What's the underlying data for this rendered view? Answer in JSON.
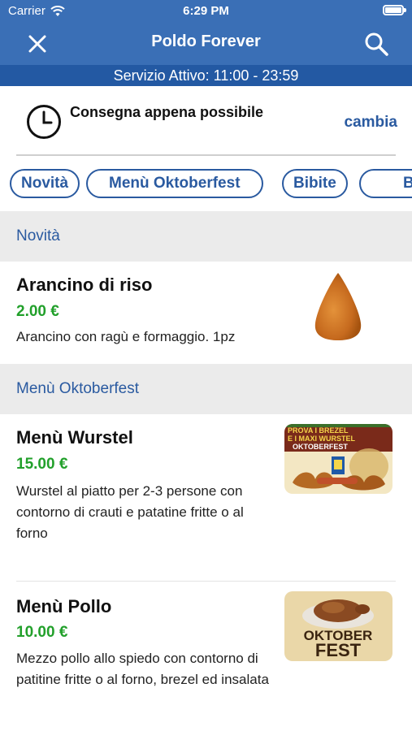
{
  "status": {
    "carrier": "Carrier",
    "time": "6:29 PM"
  },
  "navbar": {
    "title": "Poldo Forever"
  },
  "service": {
    "text": "Servizio Attivo: 11:00 - 23:59"
  },
  "delivery": {
    "text": "Consegna appena possibile",
    "change_label": "cambia"
  },
  "categories": [
    "Novità",
    "Menù Oktoberfest",
    "Bibite",
    "B"
  ],
  "sections": [
    {
      "title": "Novità",
      "items": [
        {
          "name": "Arancino di riso",
          "price": "2.00 €",
          "description": "Arancino con ragù e formaggio. 1pz"
        }
      ]
    },
    {
      "title": "Menù Oktoberfest",
      "items": [
        {
          "name": "Menù Wurstel",
          "price": "15.00 €",
          "description": "Wurstel al piatto per 2-3 persone con contorno di crauti e patatine fritte o al forno",
          "image_text": [
            "PROVA I BREZEL",
            "E I MAXI WURSTEL",
            "OKTOBERFEST"
          ]
        },
        {
          "name": "Menù Pollo",
          "price": "10.00 €",
          "description": "Mezzo pollo allo spiedo con contorno di patitine fritte o al forno, brezel ed insalata",
          "image_text": [
            "OKTOBER",
            "FEST"
          ]
        }
      ]
    }
  ],
  "colors": {
    "primary": "#3a6fb6",
    "service_bar": "#2359a3",
    "accent": "#2a5aa0",
    "price": "#22a02b"
  }
}
